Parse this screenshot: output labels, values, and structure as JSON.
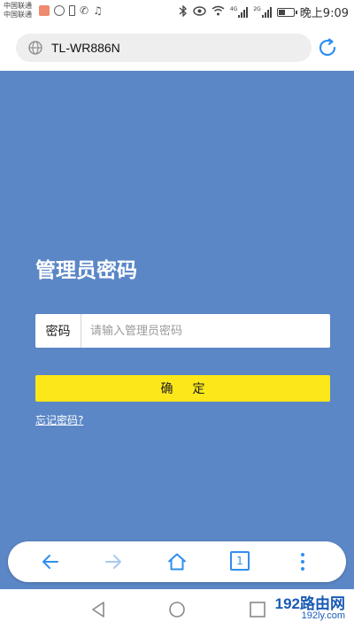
{
  "status_bar": {
    "carrier_1": "中国联通",
    "carrier_2": "中国联通",
    "network_badge_1": "4G",
    "network_badge_2": "2G",
    "time": "晚上9:09",
    "icons": [
      "bluetooth-icon",
      "eye-icon",
      "wifi-icon",
      "signal-icon",
      "battery-icon"
    ]
  },
  "address_bar": {
    "url": "TL-WR886N",
    "icons": [
      "globe-icon",
      "refresh-icon"
    ]
  },
  "login": {
    "title": "管理员密码",
    "password_label": "密码",
    "password_placeholder": "请输入管理员密码",
    "password_value": "",
    "confirm_label": "确定",
    "forgot_link": "忘记密码?"
  },
  "browser_nav": {
    "tab_count": "1",
    "icons": [
      "back-arrow-icon",
      "forward-arrow-icon",
      "home-icon",
      "tabs-icon",
      "more-icon"
    ]
  },
  "watermark": {
    "main": "192路由网",
    "sub": "192ly.com"
  },
  "colors": {
    "page_background": "#5b87c6",
    "confirm_button": "#fbe71a",
    "accent_blue": "#2f8ff0"
  }
}
